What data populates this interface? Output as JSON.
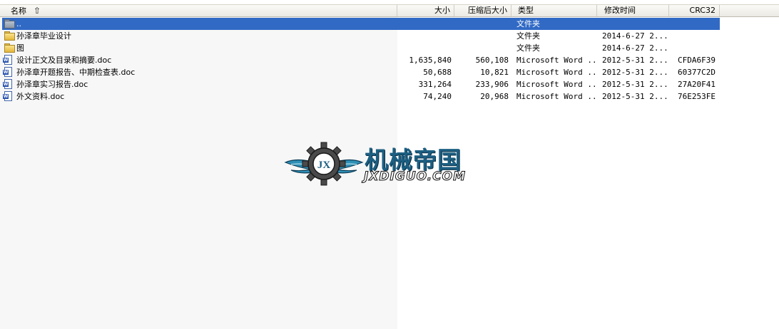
{
  "columns": {
    "name": "名称",
    "size": "大小",
    "packed": "压缩后大小",
    "type": "类型",
    "modified": "修改时间",
    "crc": "CRC32"
  },
  "rows": [
    {
      "icon": "folder-up-icon",
      "name": "..",
      "size": "",
      "packed": "",
      "type": "文件夹",
      "modified": "",
      "crc": "",
      "selected": true
    },
    {
      "icon": "folder-icon",
      "name": "孙泽章毕业设计",
      "size": "",
      "packed": "",
      "type": "文件夹",
      "modified": "2014-6-27 2...",
      "crc": ""
    },
    {
      "icon": "folder-icon",
      "name": "图",
      "size": "",
      "packed": "",
      "type": "文件夹",
      "modified": "2014-6-27 2...",
      "crc": ""
    },
    {
      "icon": "word-doc-icon",
      "name": "设计正文及目录和摘要.doc",
      "size": "1,635,840",
      "packed": "560,108",
      "type": "Microsoft Word ...",
      "modified": "2012-5-31 2...",
      "crc": "CFDA6F39"
    },
    {
      "icon": "word-doc-icon",
      "name": "孙泽章开题报告、中期检查表.doc",
      "size": "50,688",
      "packed": "10,821",
      "type": "Microsoft Word ...",
      "modified": "2012-5-31 2...",
      "crc": "60377C2D"
    },
    {
      "icon": "word-doc-icon",
      "name": "孙泽章实习报告.doc",
      "size": "331,264",
      "packed": "233,906",
      "type": "Microsoft Word ...",
      "modified": "2012-5-31 2...",
      "crc": "27A20F41"
    },
    {
      "icon": "word-doc-icon",
      "name": "外文资料.doc",
      "size": "74,240",
      "packed": "20,968",
      "type": "Microsoft Word ...",
      "modified": "2012-5-31 2...",
      "crc": "76E253FE"
    }
  ],
  "watermark": {
    "title_cn": "机械帝国",
    "title_en": "JXDIGUO.COM",
    "badge": "JX",
    "colors": {
      "brand": "#1c5f82",
      "wing": "#2f8fb5"
    }
  },
  "colors": {
    "selection": "#316ac5",
    "left_pane": "#f7f7f7"
  }
}
